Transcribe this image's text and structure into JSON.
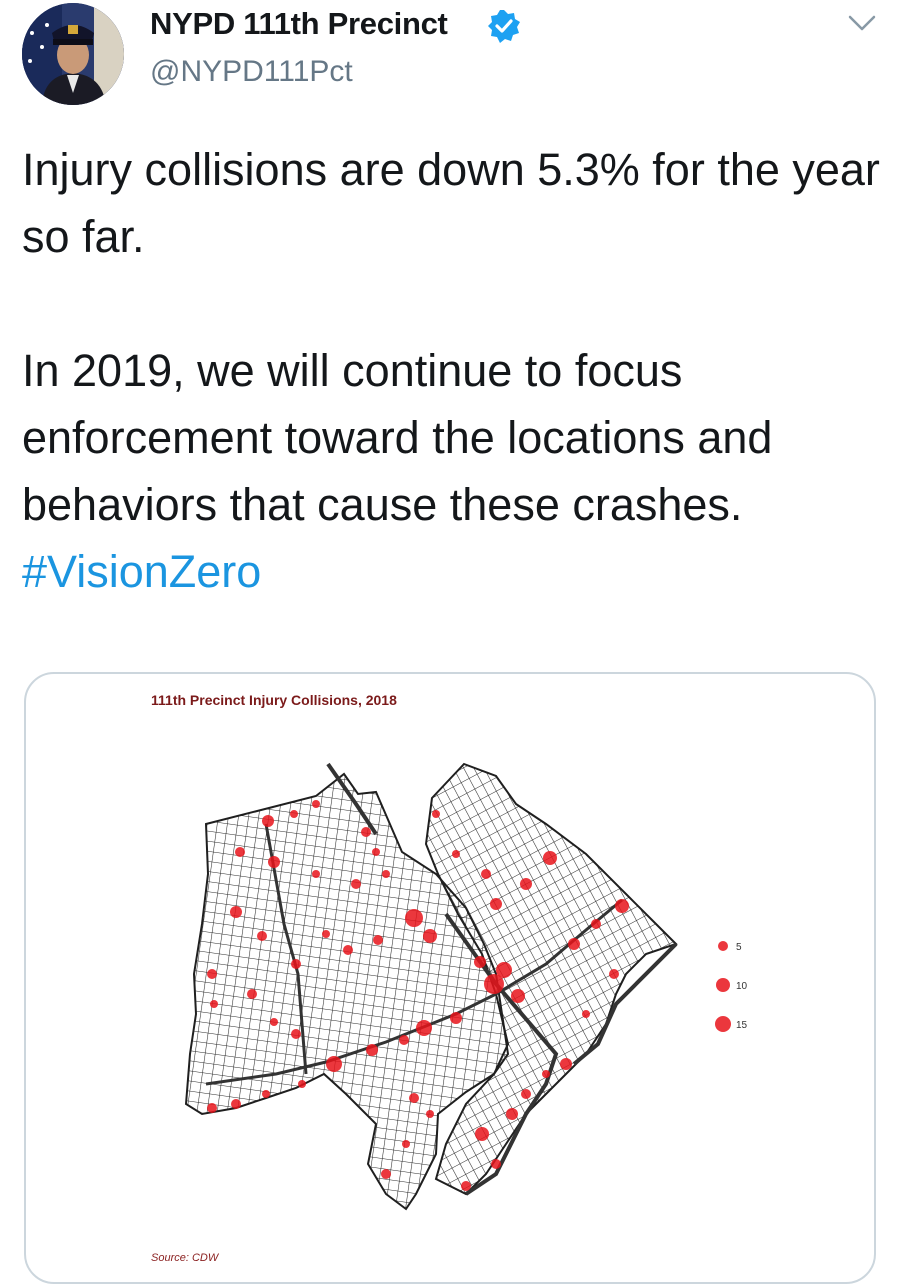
{
  "tweet": {
    "display_name": "NYPD 111th Precinct",
    "handle": "@NYPD111Pct",
    "verified": true,
    "text_p1": "Injury collisions are down 5.3% for the year so far.",
    "text_p2": "In 2019, we will continue to focus enforcement toward the locations and behaviors that cause these crashes.",
    "hashtag": "#VisionZero"
  },
  "media": {
    "title": "111th Precinct Injury Collisions, 2018",
    "source": "Source: CDW",
    "legend": [
      {
        "label": "5"
      },
      {
        "label": "10"
      },
      {
        "label": "15"
      }
    ]
  },
  "icons": {
    "avatar": "officer-portrait",
    "verified": "verified-badge-icon",
    "menu": "chevron-down-icon"
  },
  "colors": {
    "hashtag": "#1b95e0",
    "verified": "#1da1f2",
    "collision_dots": "#e8141b",
    "map_title": "#7b1a1a"
  }
}
